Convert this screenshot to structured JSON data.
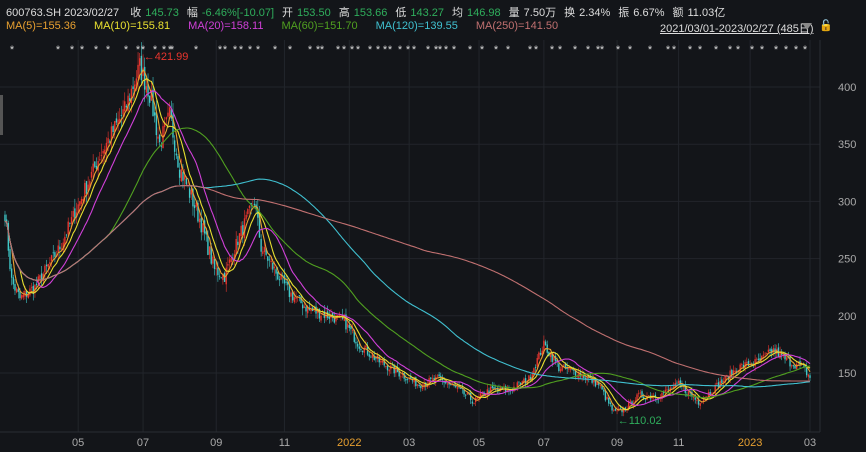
{
  "header": {
    "code": "600763.SH",
    "date": "2023/02/27",
    "fields": [
      {
        "label": "收",
        "value": "145.73"
      },
      {
        "label": "幅",
        "value": "-6.46%[-10.07]"
      },
      {
        "label": "开",
        "value": "153.50"
      },
      {
        "label": "高",
        "value": "153.66"
      },
      {
        "label": "低",
        "value": "143.27"
      },
      {
        "label": "均",
        "value": "146.98"
      },
      {
        "label": "量",
        "value": "7.50万"
      },
      {
        "label": "换",
        "value": "2.34%"
      },
      {
        "label": "振",
        "value": "6.67%"
      },
      {
        "label": "额",
        "value": "11.03亿"
      }
    ],
    "range": "2021/03/01-2023/02/27 (485日)",
    "lock_icon": "🔓"
  },
  "ma": [
    {
      "label": "MA(5)=155.36",
      "color": "#e8a030",
      "n": 5
    },
    {
      "label": "MA(10)=155.81",
      "color": "#e8e030",
      "n": 10
    },
    {
      "label": "MA(20)=158.11",
      "color": "#d040d8",
      "n": 20
    },
    {
      "label": "MA(60)=151.70",
      "color": "#50a020",
      "n": 60
    },
    {
      "label": "MA(120)=139.55",
      "color": "#40c0d0",
      "n": 120
    },
    {
      "label": "MA(250)=141.50",
      "color": "#c07070",
      "n": 250
    }
  ],
  "chart_data": {
    "type": "candlestick",
    "days": 485,
    "ylim": [
      95,
      430
    ],
    "yticks": [
      150,
      200,
      250,
      300,
      350,
      400
    ],
    "xticks": [
      {
        "day": 44,
        "label": "05"
      },
      {
        "day": 83,
        "label": "07"
      },
      {
        "day": 127,
        "label": "09"
      },
      {
        "day": 168,
        "label": "11"
      },
      {
        "day": 207,
        "label": "2022"
      },
      {
        "day": 243,
        "label": "03"
      },
      {
        "day": 285,
        "label": "05"
      },
      {
        "day": 324,
        "label": "07"
      },
      {
        "day": 368,
        "label": "09"
      },
      {
        "day": 405,
        "label": "11"
      },
      {
        "day": 448,
        "label": "2023"
      },
      {
        "day": 484,
        "label": "03"
      }
    ],
    "anchors": [
      [
        0,
        290
      ],
      [
        4,
        230
      ],
      [
        9,
        215
      ],
      [
        18,
        225
      ],
      [
        33,
        260
      ],
      [
        45,
        300
      ],
      [
        57,
        340
      ],
      [
        72,
        380
      ],
      [
        81,
        418
      ],
      [
        87,
        395
      ],
      [
        93,
        350
      ],
      [
        99,
        375
      ],
      [
        105,
        330
      ],
      [
        117,
        285
      ],
      [
        126,
        240
      ],
      [
        132,
        235
      ],
      [
        141,
        270
      ],
      [
        150,
        300
      ],
      [
        154,
        260
      ],
      [
        162,
        240
      ],
      [
        171,
        220
      ],
      [
        183,
        205
      ],
      [
        195,
        200
      ],
      [
        204,
        195
      ],
      [
        213,
        175
      ],
      [
        225,
        160
      ],
      [
        237,
        150
      ],
      [
        249,
        140
      ],
      [
        261,
        145
      ],
      [
        273,
        135
      ],
      [
        282,
        125
      ],
      [
        291,
        135
      ],
      [
        303,
        135
      ],
      [
        315,
        145
      ],
      [
        324,
        175
      ],
      [
        333,
        155
      ],
      [
        345,
        150
      ],
      [
        357,
        140
      ],
      [
        366,
        115
      ],
      [
        372,
        118
      ],
      [
        381,
        130
      ],
      [
        393,
        130
      ],
      [
        405,
        140
      ],
      [
        417,
        125
      ],
      [
        429,
        140
      ],
      [
        441,
        155
      ],
      [
        453,
        160
      ],
      [
        462,
        170
      ],
      [
        471,
        160
      ],
      [
        480,
        155
      ],
      [
        484,
        145.73
      ]
    ],
    "max": {
      "day": 81,
      "label": "421.99"
    },
    "min": {
      "day": 366,
      "label": "110.02"
    },
    "markers": [
      12,
      58,
      72,
      82,
      96,
      108,
      126,
      138,
      143,
      155,
      164,
      170,
      172,
      196,
      220,
      225,
      235,
      241,
      250,
      258,
      275,
      290,
      310,
      318,
      322,
      338,
      344,
      352,
      358,
      370,
      378,
      385,
      390,
      400,
      408,
      414,
      428,
      436,
      440,
      446,
      454,
      470,
      482,
      496,
      508,
      530,
      536,
      552,
      560,
      575,
      588,
      598,
      602,
      618,
      630,
      650,
      668,
      674,
      690,
      700,
      716,
      730,
      738,
      752,
      762,
      776,
      786,
      796,
      805
    ]
  }
}
